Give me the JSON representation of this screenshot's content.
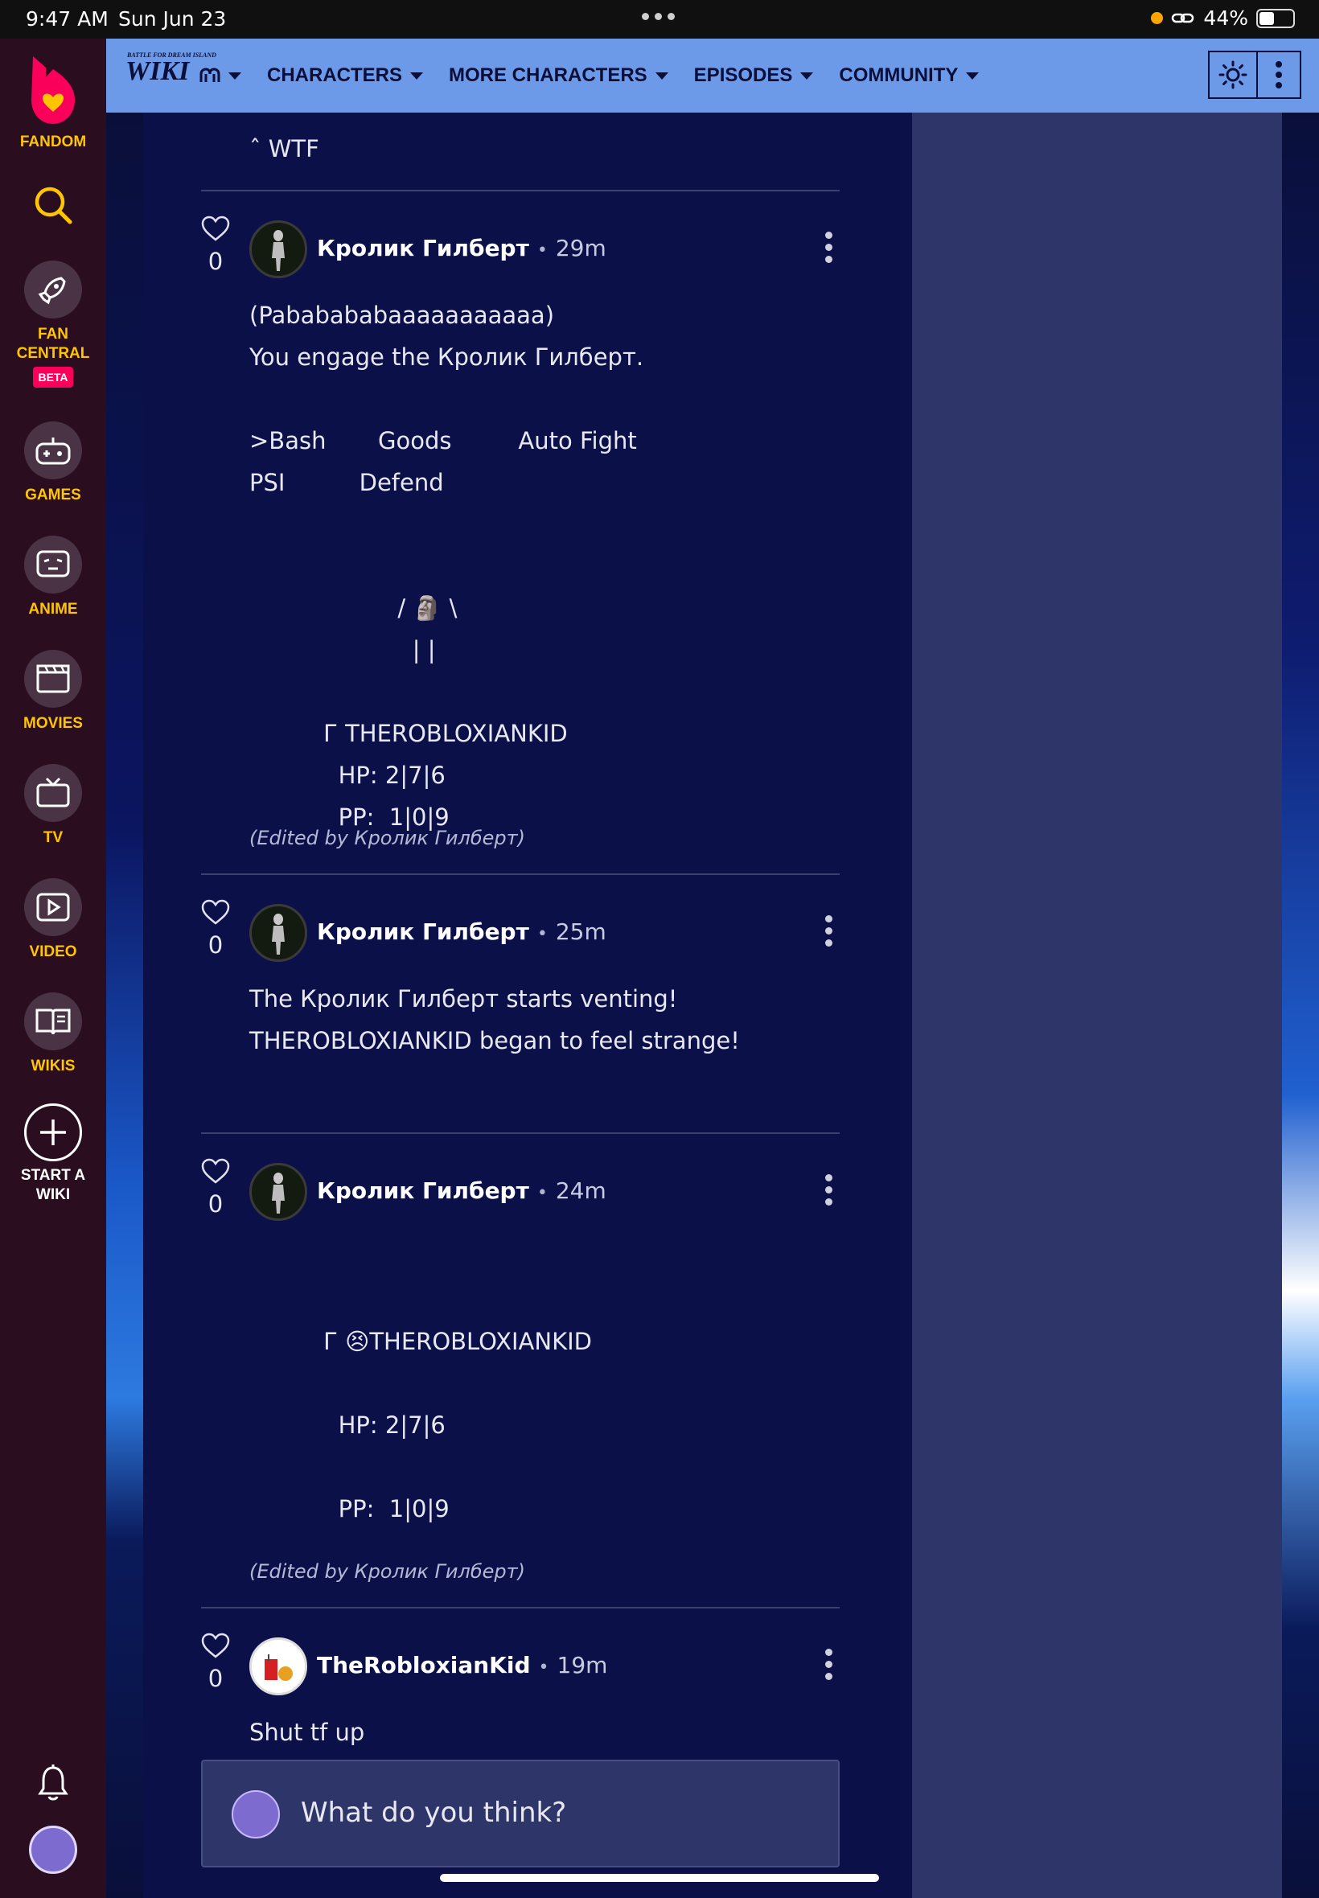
{
  "status_bar": {
    "time": "9:47 AM",
    "date": "Sun Jun 23",
    "battery": "44%",
    "battery_level": 0.44
  },
  "fandom_sidebar": {
    "logo_label": "FANDOM",
    "items": [
      {
        "label": "FAN",
        "label2": "CENTRAL",
        "badge": "BETA",
        "icon": "rocket-icon"
      },
      {
        "label": "GAMES",
        "icon": "gamepad-icon"
      },
      {
        "label": "ANIME",
        "icon": "anime-face-icon"
      },
      {
        "label": "MOVIES",
        "icon": "clapperboard-icon"
      },
      {
        "label": "TV",
        "icon": "tv-icon"
      },
      {
        "label": "VIDEO",
        "icon": "play-icon"
      },
      {
        "label": "WIKIS",
        "icon": "book-icon"
      }
    ],
    "start_wiki": {
      "line1": "START A",
      "line2": "WIKI"
    }
  },
  "wiki_nav": {
    "logo": "WIKI",
    "logo_small": "BATTLE FOR DREAM ISLAND",
    "items": [
      "CHARACTERS",
      "MORE CHARACTERS",
      "EPISODES",
      "COMMUNITY"
    ]
  },
  "thread": {
    "previous_reply_tail": "ˆ WTF",
    "posts": [
      {
        "author": "Кролик Гилберт",
        "ago": "29m",
        "likes": "0",
        "body": "(Pababababaaaaaaaaaaa)\nYou engage the Кролик Гилберт.\n\n>Bash       Goods         Auto Fight\nPSI          Defend\n\n\n                    / 🗿 \\\n                      | |\n\n          Г THEROBLOXIANKID\n            HP: 2|7|6\n            PP:  1|0|9",
        "edited": "(Edited by Кролик Гилберт)"
      },
      {
        "author": "Кролик Гилберт",
        "ago": "25m",
        "likes": "0",
        "body": "The Кролик Гилберт starts venting!\nTHEROBLOXIANKID began to feel strange!"
      },
      {
        "author": "Кролик Гилберт",
        "ago": "24m",
        "likes": "0",
        "body": "\n\n          Г 😣THEROBLOXIANKID\n\n            HP: 2|7|6\n\n            PP:  1|0|9",
        "edited": "(Edited by Кролик Гилберт)"
      },
      {
        "author": "TheRobloxianKid",
        "ago": "19m",
        "likes": "0",
        "body": "Shut tf up"
      }
    ]
  },
  "comment_input": {
    "placeholder": "What do you think?"
  }
}
